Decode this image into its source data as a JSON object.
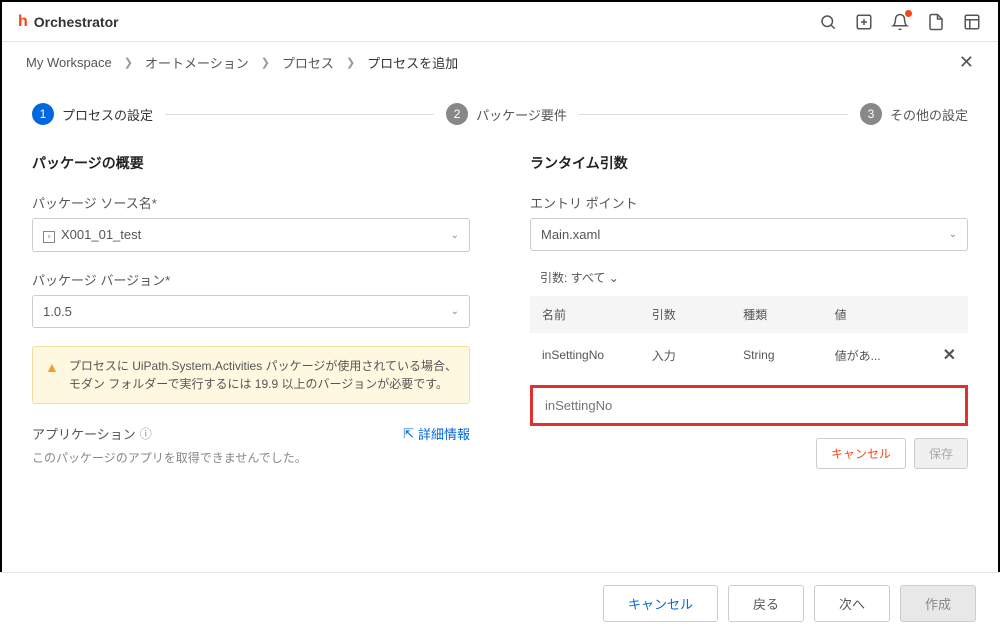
{
  "header": {
    "title": "Orchestrator"
  },
  "breadcrumb": {
    "items": [
      "My Workspace",
      "オートメーション",
      "プロセス",
      "プロセスを追加"
    ]
  },
  "stepper": {
    "steps": [
      {
        "num": "1",
        "label": "プロセスの設定"
      },
      {
        "num": "2",
        "label": "パッケージ要件"
      },
      {
        "num": "3",
        "label": "その他の設定"
      }
    ]
  },
  "left": {
    "title": "パッケージの概要",
    "source": {
      "label": "パッケージ ソース名*",
      "value": "X001_01_test"
    },
    "version": {
      "label": "パッケージ バージョン*",
      "value": "1.0.5"
    },
    "warning": "プロセスに UiPath.System.Activities パッケージが使用されている場合、モダン フォルダーで実行するには 19.9 以上のバージョンが必要です。",
    "app": {
      "title": "アプリケーション",
      "detail": "詳細情報",
      "message": "このパッケージのアプリを取得できませんでした。"
    }
  },
  "right": {
    "title": "ランタイム引数",
    "entry": {
      "label": "エントリ ポイント",
      "value": "Main.xaml"
    },
    "args_filter": "引数: すべて",
    "table": {
      "headers": {
        "name": "名前",
        "arg": "引数",
        "type": "種類",
        "val": "値"
      },
      "rows": [
        {
          "name": "inSettingNo",
          "arg": "入力",
          "type": "String",
          "val": "値があ..."
        }
      ]
    },
    "edit_placeholder": "inSettingNo",
    "buttons": {
      "cancel": "キャンセル",
      "save": "保存"
    }
  },
  "footer": {
    "cancel": "キャンセル",
    "back": "戻る",
    "next": "次へ",
    "create": "作成"
  }
}
